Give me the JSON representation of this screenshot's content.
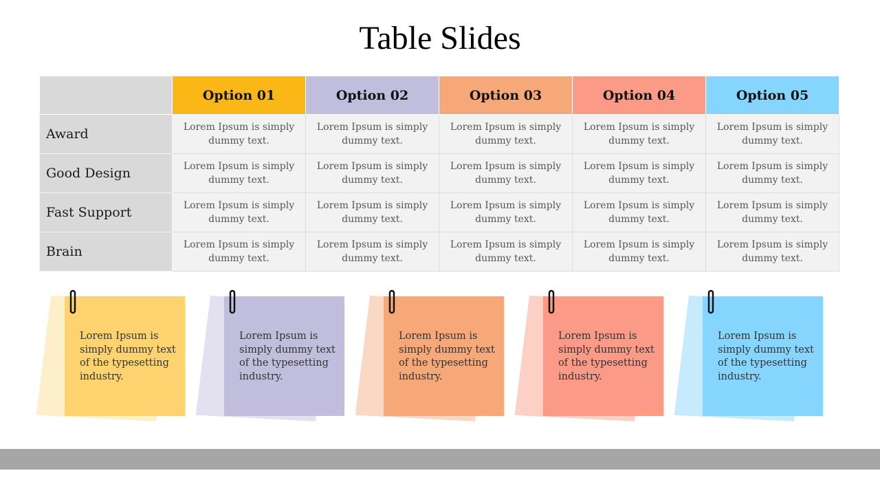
{
  "title": "Table Slides",
  "table": {
    "headers": [
      {
        "label": "Option 01",
        "color": "#fbb715"
      },
      {
        "label": "Option 02",
        "color": "#c1bddd"
      },
      {
        "label": "Option 03",
        "color": "#f6a879"
      },
      {
        "label": "Option 04",
        "color": "#fb9a87"
      },
      {
        "label": "Option 05",
        "color": "#86d5fe"
      }
    ],
    "rows": [
      {
        "label": "Award",
        "cells": [
          "Lorem Ipsum is simply dummy text.",
          "Lorem Ipsum is simply dummy text.",
          "Lorem Ipsum is simply dummy text.",
          "Lorem Ipsum is simply dummy text.",
          "Lorem Ipsum is simply dummy text."
        ]
      },
      {
        "label": "Good Design",
        "cells": [
          "Lorem Ipsum is simply dummy text.",
          "Lorem Ipsum is simply dummy text.",
          "Lorem Ipsum is simply dummy text.",
          "Lorem Ipsum is simply dummy text.",
          "Lorem Ipsum is simply dummy text."
        ]
      },
      {
        "label": "Fast Support",
        "cells": [
          "Lorem Ipsum is simply dummy text.",
          "Lorem Ipsum is simply dummy text.",
          "Lorem Ipsum is simply dummy text.",
          "Lorem Ipsum is simply dummy text.",
          "Lorem Ipsum is simply dummy text."
        ]
      },
      {
        "label": "Brain",
        "cells": [
          "Lorem Ipsum is simply dummy text.",
          "Lorem Ipsum is simply dummy text.",
          "Lorem Ipsum is simply dummy text.",
          "Lorem Ipsum is simply dummy text.",
          "Lorem Ipsum is simply dummy text."
        ]
      }
    ]
  },
  "notes": [
    {
      "text": "Lorem Ipsum is simply dummy text of the typesetting industry.",
      "color": "#fdd36f",
      "back_color": "#fdefc9",
      "icon": "paperclip-icon"
    },
    {
      "text": "Lorem Ipsum is simply dummy text of the typesetting industry.",
      "color": "#c1bddd",
      "back_color": "#e3e1f0",
      "icon": "paperclip-icon"
    },
    {
      "text": "Lorem Ipsum is simply dummy text of the typesetting industry.",
      "color": "#f6a879",
      "back_color": "#fbd8c3",
      "icon": "paperclip-icon"
    },
    {
      "text": "Lorem Ipsum is simply dummy text of the typesetting industry.",
      "color": "#fb9a87",
      "back_color": "#fdd0c6",
      "icon": "paperclip-icon"
    },
    {
      "text": "Lorem Ipsum is simply dummy text of the typesetting industry.",
      "color": "#86d5fe",
      "back_color": "#c6ebfe",
      "icon": "paperclip-icon"
    }
  ],
  "footer": {
    "color": "#a6a6a6"
  }
}
